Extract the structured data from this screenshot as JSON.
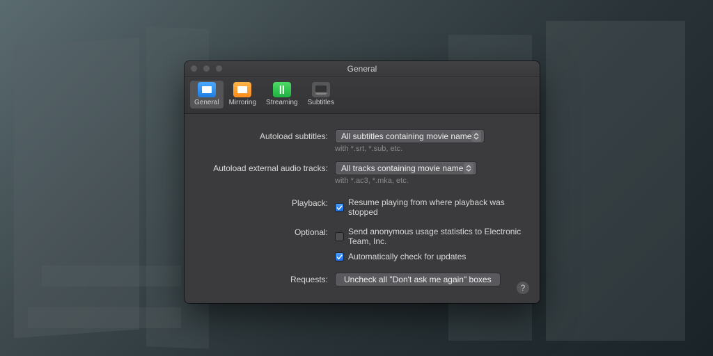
{
  "window": {
    "title": "General"
  },
  "toolbar": {
    "tabs": [
      {
        "label": "General"
      },
      {
        "label": "Mirroring"
      },
      {
        "label": "Streaming"
      },
      {
        "label": "Subtitles"
      }
    ]
  },
  "form": {
    "autoload_subs_label": "Autoload subtitles:",
    "autoload_subs_value": "All subtitles containing movie name",
    "autoload_subs_hint": "with *.srt, *.sub, etc.",
    "autoload_audio_label": "Autoload external audio tracks:",
    "autoload_audio_value": "All tracks containing movie name",
    "autoload_audio_hint": "with *.ac3, *.mka, etc.",
    "playback_label": "Playback:",
    "playback_resume": "Resume playing from where playback was stopped",
    "optional_label": "Optional:",
    "optional_stats": "Send anonymous usage statistics to Electronic Team, Inc.",
    "optional_updates": "Automatically check for updates",
    "requests_label": "Requests:",
    "requests_button": "Uncheck all \"Don't ask me again\" boxes",
    "help": "?"
  }
}
